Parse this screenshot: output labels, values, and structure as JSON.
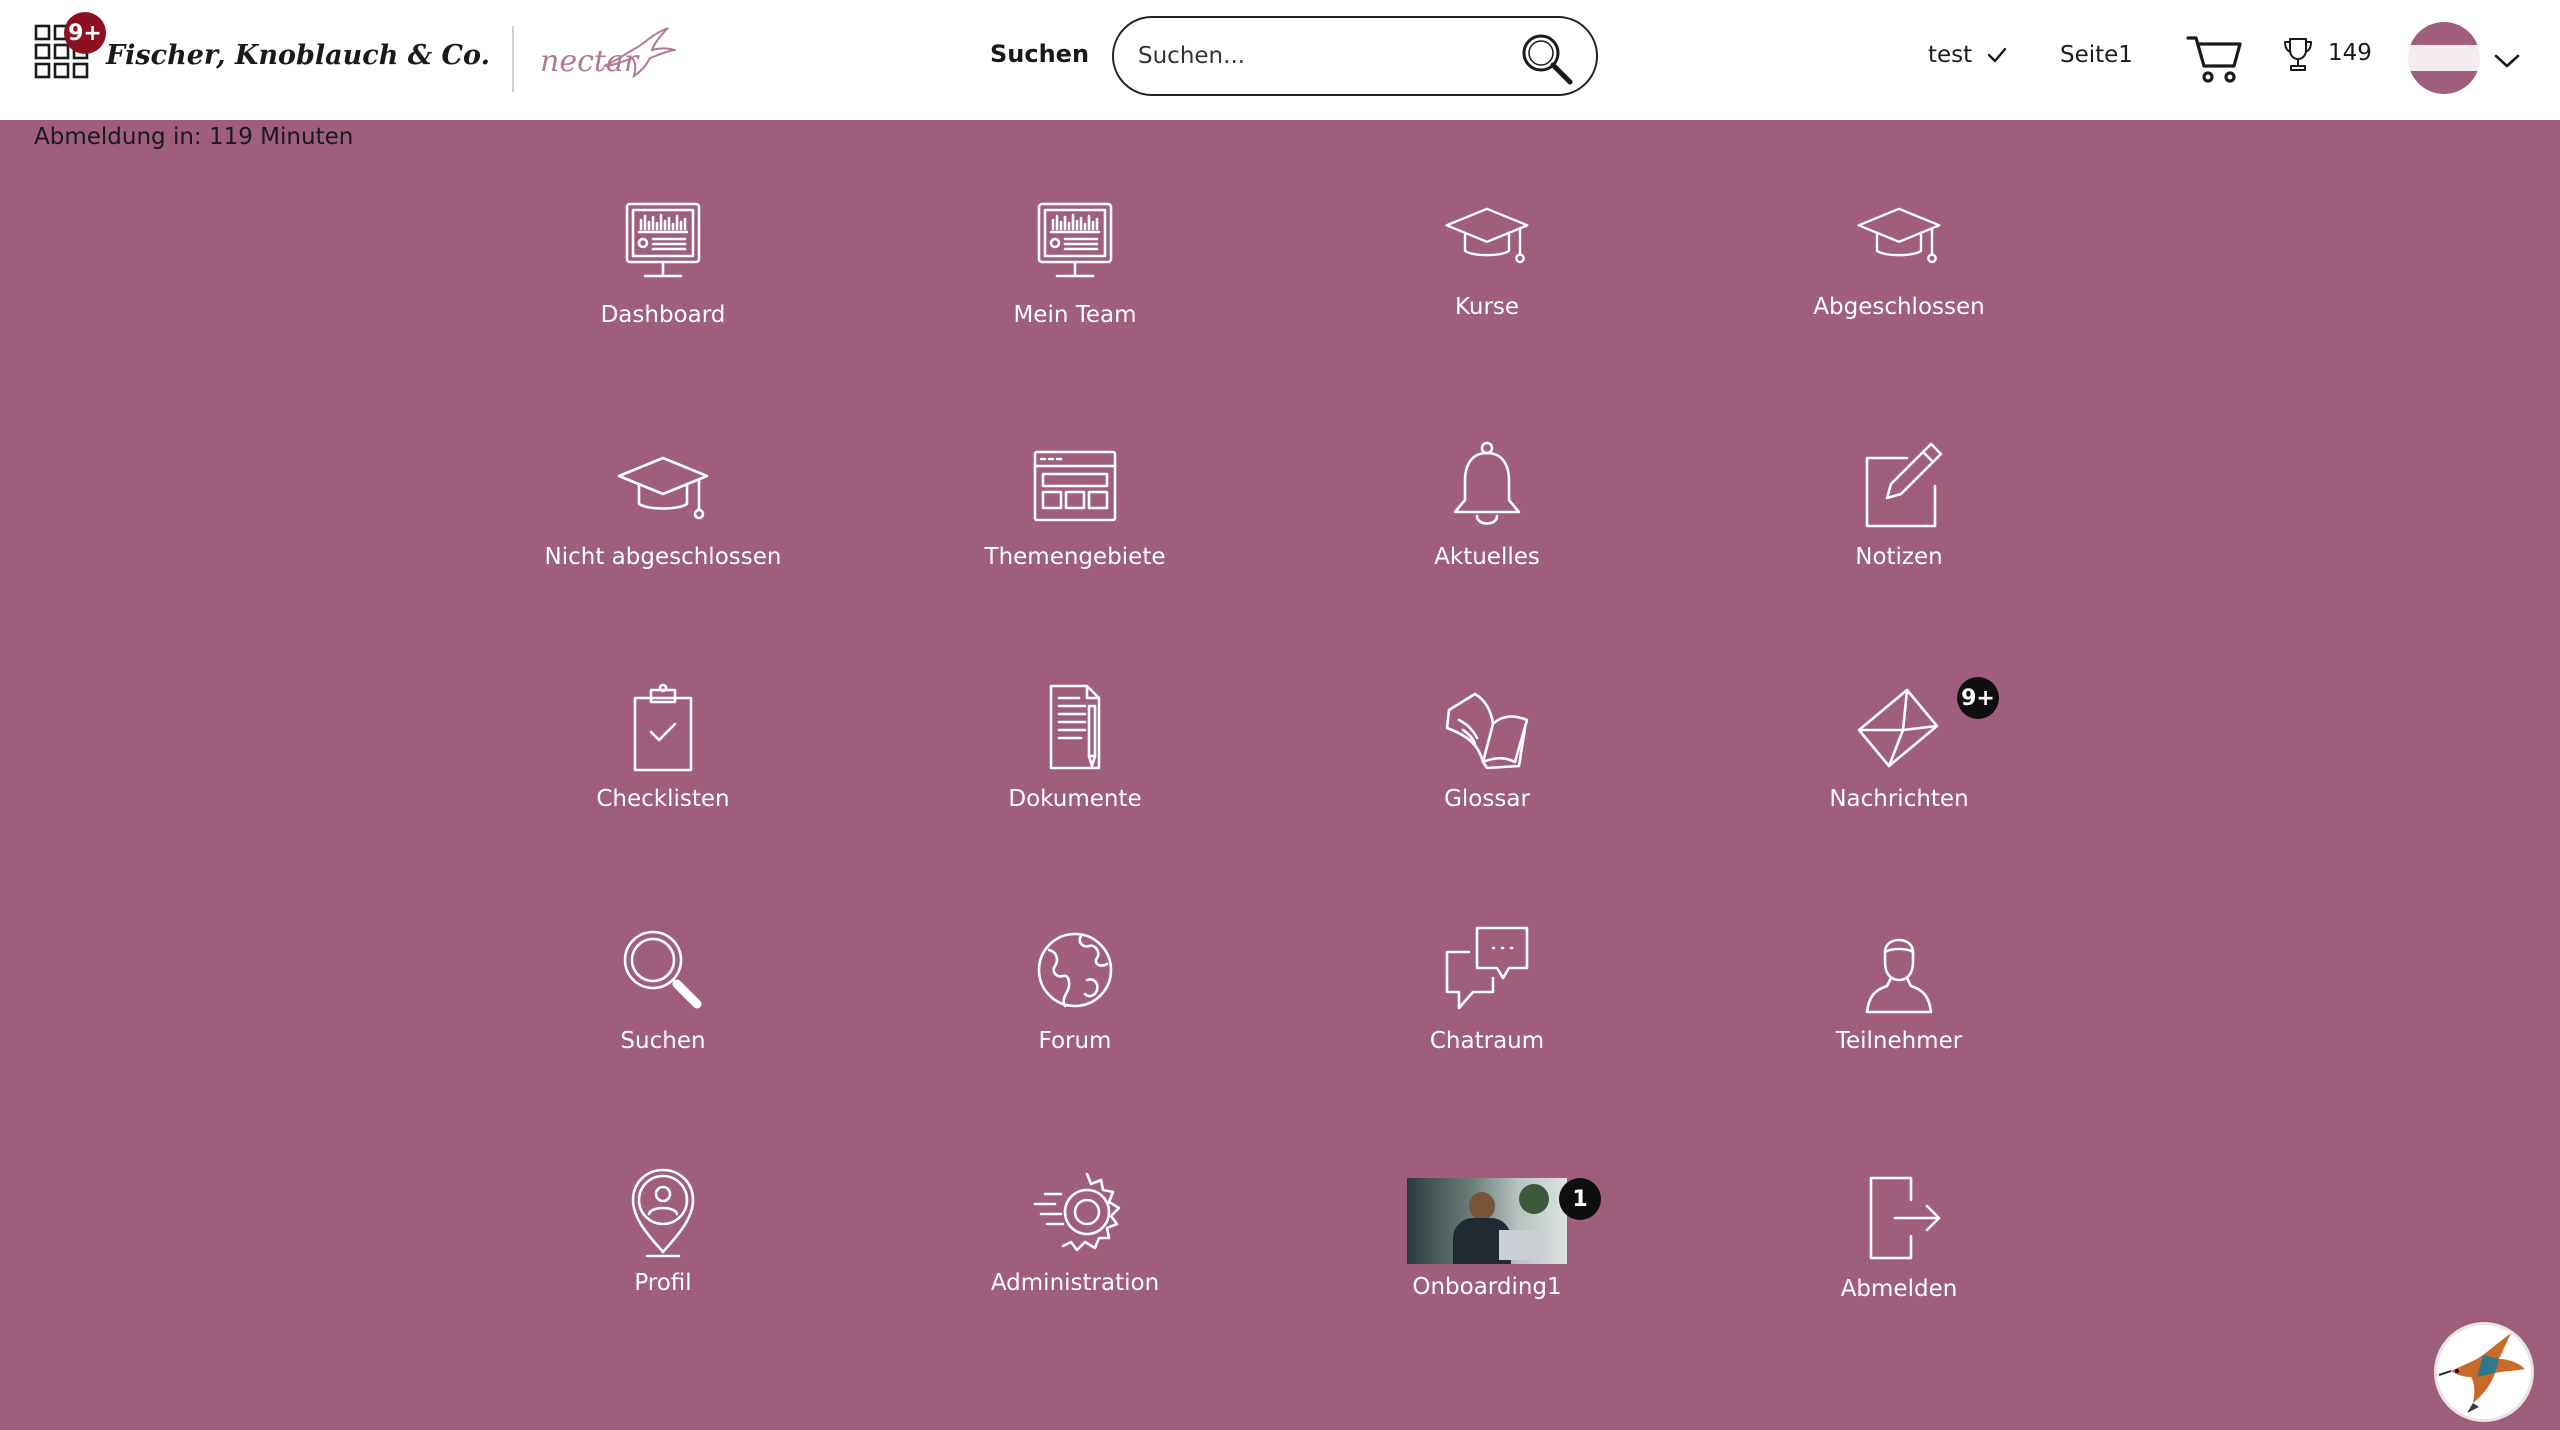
{
  "header": {
    "apps_badge": "9+",
    "brand": "Fischer, Knoblauch & Co.",
    "sub_brand": "nectar",
    "search_label": "Suchen",
    "search_placeholder": "Suchen...",
    "user_name": "test",
    "page_link": "Seite1",
    "points": "149"
  },
  "session": {
    "logout_timer": "Abmeldung in: 119 Minuten"
  },
  "tiles": [
    {
      "label": "Dashboard",
      "icon": "monitor-chart-icon"
    },
    {
      "label": "Mein Team",
      "icon": "monitor-chart-icon"
    },
    {
      "label": "Kurse",
      "icon": "graduation-cap-icon"
    },
    {
      "label": "Abgeschlossen",
      "icon": "graduation-cap-icon"
    },
    {
      "label": "Nicht abgeschlossen",
      "icon": "graduation-cap-icon"
    },
    {
      "label": "Themengebiete",
      "icon": "browser-window-icon"
    },
    {
      "label": "Aktuelles",
      "icon": "bell-icon"
    },
    {
      "label": "Notizen",
      "icon": "edit-note-icon"
    },
    {
      "label": "Checklisten",
      "icon": "clipboard-check-icon"
    },
    {
      "label": "Dokumente",
      "icon": "document-pen-icon"
    },
    {
      "label": "Glossar",
      "icon": "open-book-icon"
    },
    {
      "label": "Nachrichten",
      "icon": "envelope-icon",
      "badge": "9+"
    },
    {
      "label": "Suchen",
      "icon": "magnifier-icon"
    },
    {
      "label": "Forum",
      "icon": "globe-icon"
    },
    {
      "label": "Chatraum",
      "icon": "chat-bubbles-icon"
    },
    {
      "label": "Teilnehmer",
      "icon": "person-icon"
    },
    {
      "label": "Profil",
      "icon": "location-person-icon"
    },
    {
      "label": "Administration",
      "icon": "gear-icon"
    },
    {
      "label": "Onboarding1",
      "icon": "onboarding-thumbnail",
      "badge": "1"
    },
    {
      "label": "Abmelden",
      "icon": "logout-icon"
    }
  ],
  "colors": {
    "background": "#9e5e7c",
    "header": "#ffffff",
    "badge_dark": "#0f0f0f",
    "badge_red": "#8c1020"
  }
}
